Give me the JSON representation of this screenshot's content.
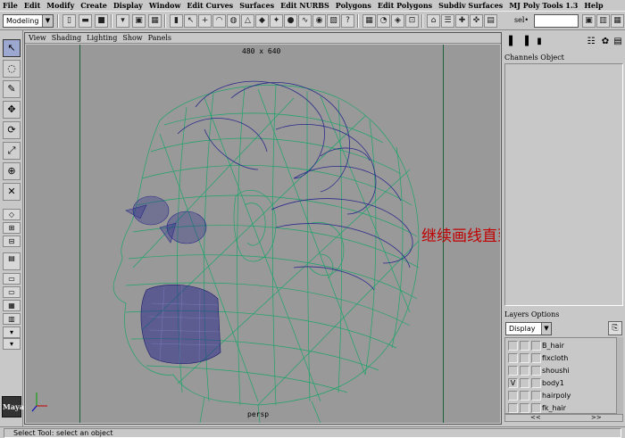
{
  "menubar": [
    "File",
    "Edit",
    "Modify",
    "Create",
    "Display",
    "Window",
    "Edit Curves",
    "Surfaces",
    "Edit NURBS",
    "Polygons",
    "Edit Polygons",
    "Subdiv Surfaces",
    "MJ Poly Tools 1.3",
    "Help"
  ],
  "statusline": {
    "mode": "Modeling",
    "sel_label": "sel•",
    "sel_value": ""
  },
  "panel_menu": [
    "View",
    "Shading",
    "Lighting",
    "Show",
    "Panels"
  ],
  "viewport": {
    "resolution": "480 x 640",
    "camera": "persp",
    "annotation": "继续画线直到后脑。"
  },
  "channels": {
    "menu": [
      "Channels",
      "Object"
    ]
  },
  "layers": {
    "menu": [
      "Layers",
      "Options"
    ],
    "display_mode": "Display",
    "items": [
      {
        "name": "B_hair",
        "visible": ""
      },
      {
        "name": "fixcloth",
        "visible": ""
      },
      {
        "name": "shoushi",
        "visible": ""
      },
      {
        "name": "body1",
        "visible": "V"
      },
      {
        "name": "hairpoly",
        "visible": ""
      },
      {
        "name": "fk_hair",
        "visible": ""
      }
    ],
    "scroll_left": "<<",
    "scroll_right": ">>"
  },
  "helpline": "Select Tool: select an object",
  "logo": "Maya",
  "colors": {
    "ui_gray": "#c8c8c8",
    "viewport_bg": "#999999",
    "wire_green": "#1ea46a",
    "wire_blue": "#2a2a8a",
    "annotation": "#c00000"
  }
}
